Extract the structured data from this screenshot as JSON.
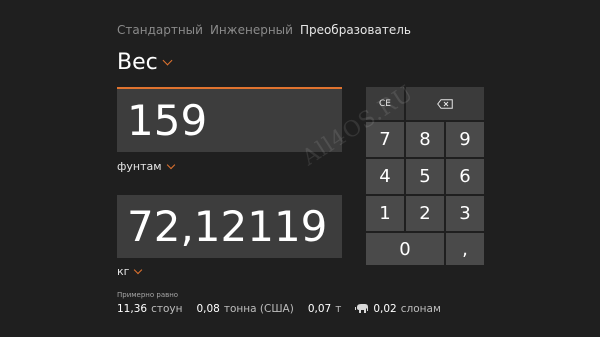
{
  "tabs": [
    {
      "label": "Стандартный",
      "active": false
    },
    {
      "label": "Инженерный",
      "active": false
    },
    {
      "label": "Преобразователь",
      "active": true
    }
  ],
  "category": {
    "label": "Вес",
    "icon": "chevron-down-icon"
  },
  "from": {
    "value": "159",
    "unit": "фунтам"
  },
  "to": {
    "value": "72,12119",
    "unit": "кг"
  },
  "approx_label": "Примерно равно",
  "equivalents": [
    {
      "value": "11,36",
      "unit": "стоун"
    },
    {
      "value": "0,08",
      "unit": "тонна (США)"
    },
    {
      "value": "0,07",
      "unit": "т"
    },
    {
      "value": "0,02",
      "unit": "слонам",
      "icon": "elephant-icon"
    }
  ],
  "keypad": {
    "ce": "CE",
    "backspace_icon": "backspace-icon",
    "digits": [
      "7",
      "8",
      "9",
      "4",
      "5",
      "6",
      "1",
      "2",
      "3"
    ],
    "zero": "0",
    "decimal": ","
  },
  "watermark": "All4OS.RU",
  "colors": {
    "background": "#1f1f1f",
    "accent": "#e0732f",
    "box": "#3d3d3d",
    "key": "#4a4a4a"
  }
}
